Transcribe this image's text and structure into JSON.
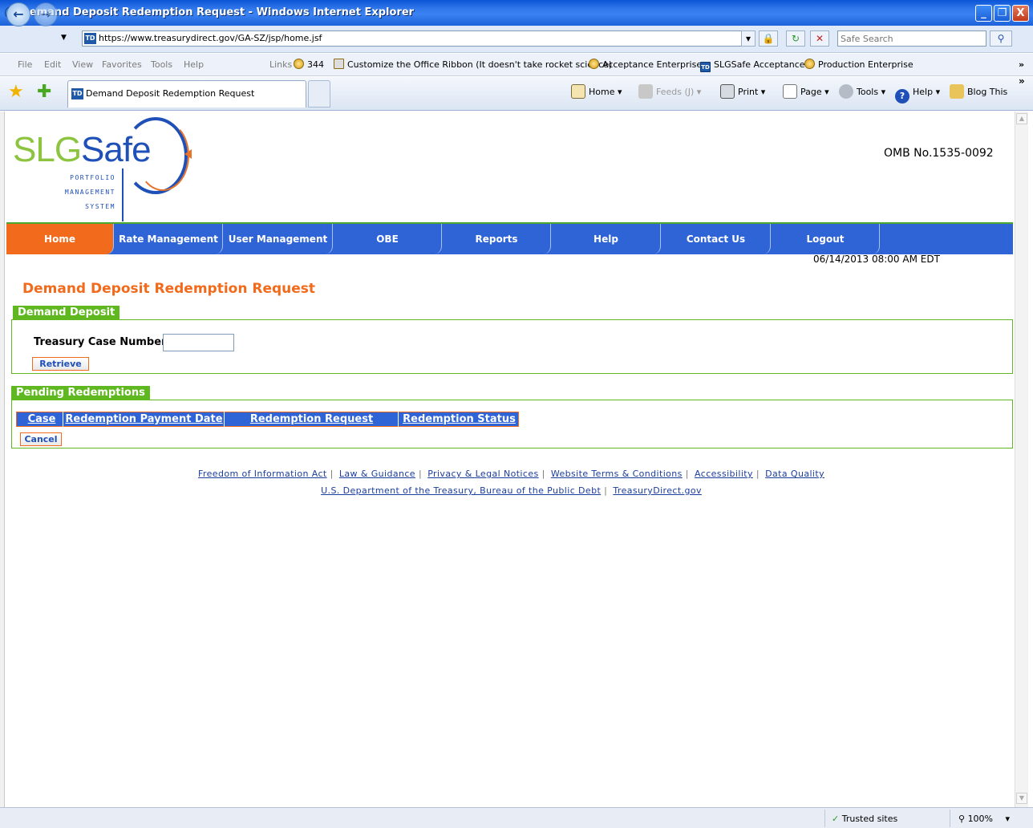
{
  "window": {
    "title": "Demand Deposit Redemption Request - Windows Internet Explorer",
    "minimize": "_",
    "restore": "❐",
    "close": "X"
  },
  "address_bar": {
    "url": "https://www.treasurydirect.gov/GA-SZ/jsp/home.jsf",
    "search_placeholder": "Safe Search",
    "site_icon": "TD"
  },
  "menu": {
    "items": [
      "File",
      "Edit",
      "View",
      "Favorites",
      "Tools",
      "Help"
    ],
    "links_label": "Links",
    "links": [
      "344",
      "Customize the Office Ribbon (It doesn't take rocket science)",
      "Acceptance Enterprise",
      "SLGSafe Acceptance",
      "Production Enterprise"
    ]
  },
  "tab": {
    "label": "Demand Deposit Redemption Request",
    "site_icon": "TD"
  },
  "commands": {
    "home": "Home",
    "feeds": "Feeds (J)",
    "print": "Print",
    "page": "Page",
    "tools": "Tools",
    "help": "Help",
    "blog": "Blog This"
  },
  "logo": {
    "part1": "SLG",
    "part2": "Safe",
    "sub1": "PORTFOLIO",
    "sub2": "MANAGEMENT",
    "sub3": "SYSTEM"
  },
  "omb": "OMB No.1535-0092",
  "nav": [
    "Home",
    "Rate Management",
    "User Management",
    "OBE",
    "Reports",
    "Help",
    "Contact Us",
    "Logout"
  ],
  "datetime": "06/14/2013 08:00 AM EDT",
  "page_title": "Demand Deposit Redemption Request",
  "demand_deposit": {
    "section_label": "Demand Deposit",
    "case_label": "Treasury Case Number",
    "case_value": "",
    "retrieve_button": "Retrieve"
  },
  "pending": {
    "section_label": "Pending Redemptions",
    "columns": [
      "Case",
      "Redemption Payment Date",
      "Redemption Request Number",
      "Redemption Status"
    ],
    "cancel_button": "Cancel"
  },
  "footer": {
    "row1": [
      "Freedom of Information Act",
      "Law & Guidance",
      "Privacy & Legal Notices",
      "Website Terms & Conditions",
      "Accessibility",
      "Data Quality"
    ],
    "row2": [
      "U.S. Department of the Treasury, Bureau of the Public Debt",
      "TreasuryDirect.gov"
    ],
    "separator": "|"
  },
  "status": {
    "zone": "Trusted sites",
    "zoom": "100%"
  },
  "colors": {
    "nav_blue": "#2f64d6",
    "nav_active_orange": "#f26a1b",
    "section_green": "#5fb81f"
  }
}
